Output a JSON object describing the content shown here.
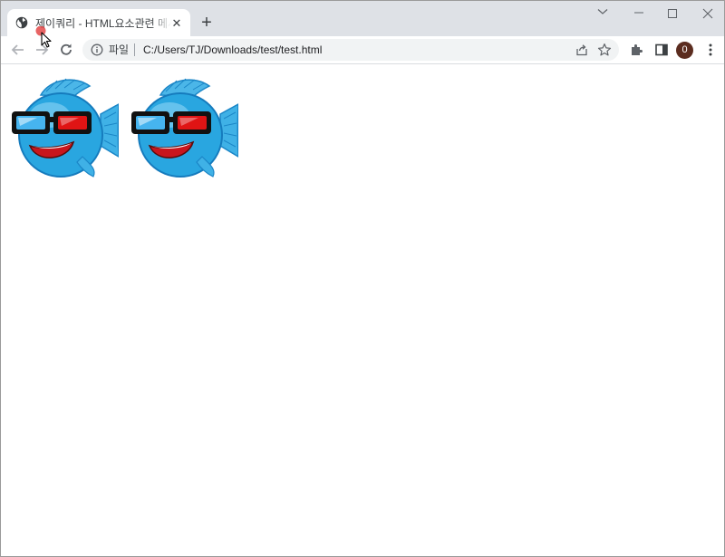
{
  "tab": {
    "title": "제이쿼리 - HTML요소관련 메서드",
    "favicon": "globe-icon"
  },
  "toolbar": {
    "page_info_label": "파일",
    "url": "C:/Users/TJ/Downloads/test/test.html",
    "profile_initial": "0"
  },
  "page": {
    "image_count": 2
  },
  "colors": {
    "titlebar": "#dee1e6",
    "omnibox": "#f1f3f4",
    "avatar": "#5b2c1f",
    "fish_body": "#29a6e0"
  }
}
